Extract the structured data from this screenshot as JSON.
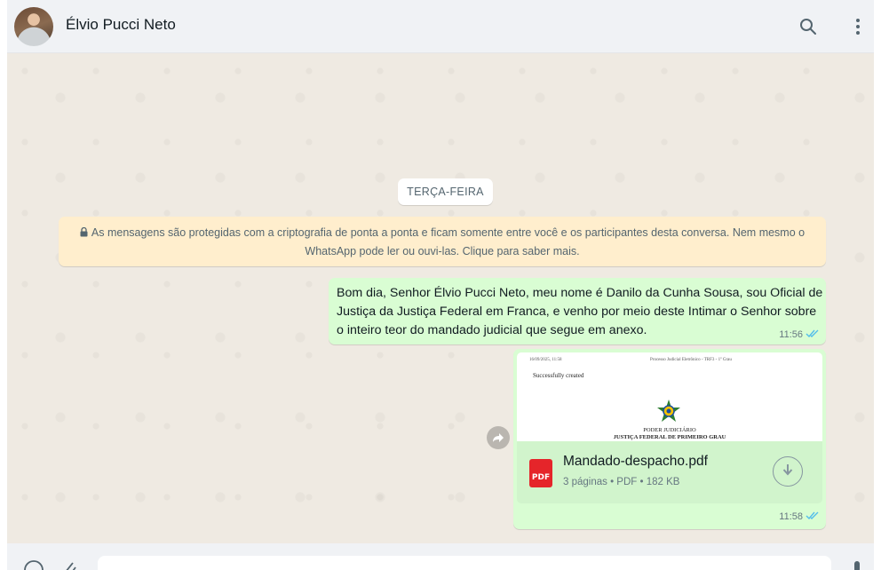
{
  "header": {
    "contact_name": "Élvio Pucci Neto",
    "icons": [
      "search-icon",
      "menu-icon"
    ]
  },
  "chat": {
    "date_chip": "TERÇA-FEIRA",
    "encryption_notice": "As mensagens são protegidas com a criptografia de ponta a ponta e ficam somente entre você e os participantes desta conversa. Nem mesmo o WhatsApp pode ler ou ouvi-las. Clique para saber mais.",
    "messages": [
      {
        "text": "Bom dia, Senhor Élvio Pucci Neto, meu nome é Danilo da Cunha Sousa, sou Oficial de Justiça da Justiça Federal em Franca, e venho por meio deste Intimar o Senhor sobre o inteiro teor do mandado judicial que segue em anexo.",
        "time": "11:56",
        "status": "read"
      },
      {
        "type": "document",
        "preview": {
          "timestamp": "16/09/2025, 11:58",
          "top_right": "Processo Judicial Eletrônico - TRF3 - 1º Grau",
          "status_text": "Successfully created",
          "org_line1": "PODER JUDICIÁRIO",
          "org_line2": "JUSTIÇA FEDERAL DE PRIMEIRO GRAU"
        },
        "file_name": "Mandado-despacho.pdf",
        "file_info": "3 páginas • PDF • 182 KB",
        "file_type_label": "PDF",
        "time": "11:58",
        "status": "read"
      }
    ]
  },
  "colors": {
    "chat_bg": "#efeae2",
    "outgoing_bubble": "#d9fdd3",
    "notice_bg": "#ffeecd",
    "read_tick": "#53bdeb",
    "pdf_red": "#e5252a"
  }
}
